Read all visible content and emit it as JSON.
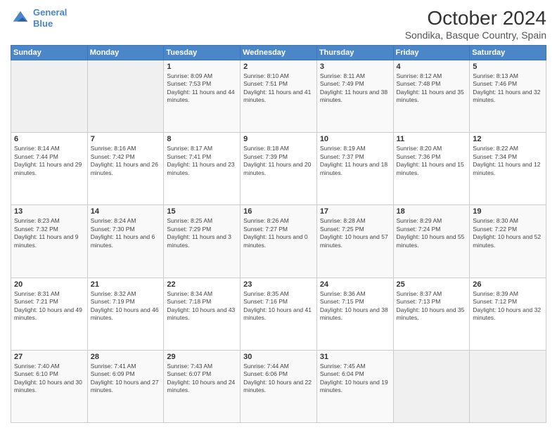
{
  "header": {
    "logo_line1": "General",
    "logo_line2": "Blue",
    "month": "October 2024",
    "location": "Sondika, Basque Country, Spain"
  },
  "days_of_week": [
    "Sunday",
    "Monday",
    "Tuesday",
    "Wednesday",
    "Thursday",
    "Friday",
    "Saturday"
  ],
  "weeks": [
    [
      {
        "day": "",
        "info": ""
      },
      {
        "day": "",
        "info": ""
      },
      {
        "day": "1",
        "info": "Sunrise: 8:09 AM\nSunset: 7:53 PM\nDaylight: 11 hours and 44 minutes."
      },
      {
        "day": "2",
        "info": "Sunrise: 8:10 AM\nSunset: 7:51 PM\nDaylight: 11 hours and 41 minutes."
      },
      {
        "day": "3",
        "info": "Sunrise: 8:11 AM\nSunset: 7:49 PM\nDaylight: 11 hours and 38 minutes."
      },
      {
        "day": "4",
        "info": "Sunrise: 8:12 AM\nSunset: 7:48 PM\nDaylight: 11 hours and 35 minutes."
      },
      {
        "day": "5",
        "info": "Sunrise: 8:13 AM\nSunset: 7:46 PM\nDaylight: 11 hours and 32 minutes."
      }
    ],
    [
      {
        "day": "6",
        "info": "Sunrise: 8:14 AM\nSunset: 7:44 PM\nDaylight: 11 hours and 29 minutes."
      },
      {
        "day": "7",
        "info": "Sunrise: 8:16 AM\nSunset: 7:42 PM\nDaylight: 11 hours and 26 minutes."
      },
      {
        "day": "8",
        "info": "Sunrise: 8:17 AM\nSunset: 7:41 PM\nDaylight: 11 hours and 23 minutes."
      },
      {
        "day": "9",
        "info": "Sunrise: 8:18 AM\nSunset: 7:39 PM\nDaylight: 11 hours and 20 minutes."
      },
      {
        "day": "10",
        "info": "Sunrise: 8:19 AM\nSunset: 7:37 PM\nDaylight: 11 hours and 18 minutes."
      },
      {
        "day": "11",
        "info": "Sunrise: 8:20 AM\nSunset: 7:36 PM\nDaylight: 11 hours and 15 minutes."
      },
      {
        "day": "12",
        "info": "Sunrise: 8:22 AM\nSunset: 7:34 PM\nDaylight: 11 hours and 12 minutes."
      }
    ],
    [
      {
        "day": "13",
        "info": "Sunrise: 8:23 AM\nSunset: 7:32 PM\nDaylight: 11 hours and 9 minutes."
      },
      {
        "day": "14",
        "info": "Sunrise: 8:24 AM\nSunset: 7:30 PM\nDaylight: 11 hours and 6 minutes."
      },
      {
        "day": "15",
        "info": "Sunrise: 8:25 AM\nSunset: 7:29 PM\nDaylight: 11 hours and 3 minutes."
      },
      {
        "day": "16",
        "info": "Sunrise: 8:26 AM\nSunset: 7:27 PM\nDaylight: 11 hours and 0 minutes."
      },
      {
        "day": "17",
        "info": "Sunrise: 8:28 AM\nSunset: 7:25 PM\nDaylight: 10 hours and 57 minutes."
      },
      {
        "day": "18",
        "info": "Sunrise: 8:29 AM\nSunset: 7:24 PM\nDaylight: 10 hours and 55 minutes."
      },
      {
        "day": "19",
        "info": "Sunrise: 8:30 AM\nSunset: 7:22 PM\nDaylight: 10 hours and 52 minutes."
      }
    ],
    [
      {
        "day": "20",
        "info": "Sunrise: 8:31 AM\nSunset: 7:21 PM\nDaylight: 10 hours and 49 minutes."
      },
      {
        "day": "21",
        "info": "Sunrise: 8:32 AM\nSunset: 7:19 PM\nDaylight: 10 hours and 46 minutes."
      },
      {
        "day": "22",
        "info": "Sunrise: 8:34 AM\nSunset: 7:18 PM\nDaylight: 10 hours and 43 minutes."
      },
      {
        "day": "23",
        "info": "Sunrise: 8:35 AM\nSunset: 7:16 PM\nDaylight: 10 hours and 41 minutes."
      },
      {
        "day": "24",
        "info": "Sunrise: 8:36 AM\nSunset: 7:15 PM\nDaylight: 10 hours and 38 minutes."
      },
      {
        "day": "25",
        "info": "Sunrise: 8:37 AM\nSunset: 7:13 PM\nDaylight: 10 hours and 35 minutes."
      },
      {
        "day": "26",
        "info": "Sunrise: 8:39 AM\nSunset: 7:12 PM\nDaylight: 10 hours and 32 minutes."
      }
    ],
    [
      {
        "day": "27",
        "info": "Sunrise: 7:40 AM\nSunset: 6:10 PM\nDaylight: 10 hours and 30 minutes."
      },
      {
        "day": "28",
        "info": "Sunrise: 7:41 AM\nSunset: 6:09 PM\nDaylight: 10 hours and 27 minutes."
      },
      {
        "day": "29",
        "info": "Sunrise: 7:43 AM\nSunset: 6:07 PM\nDaylight: 10 hours and 24 minutes."
      },
      {
        "day": "30",
        "info": "Sunrise: 7:44 AM\nSunset: 6:06 PM\nDaylight: 10 hours and 22 minutes."
      },
      {
        "day": "31",
        "info": "Sunrise: 7:45 AM\nSunset: 6:04 PM\nDaylight: 10 hours and 19 minutes."
      },
      {
        "day": "",
        "info": ""
      },
      {
        "day": "",
        "info": ""
      }
    ]
  ]
}
